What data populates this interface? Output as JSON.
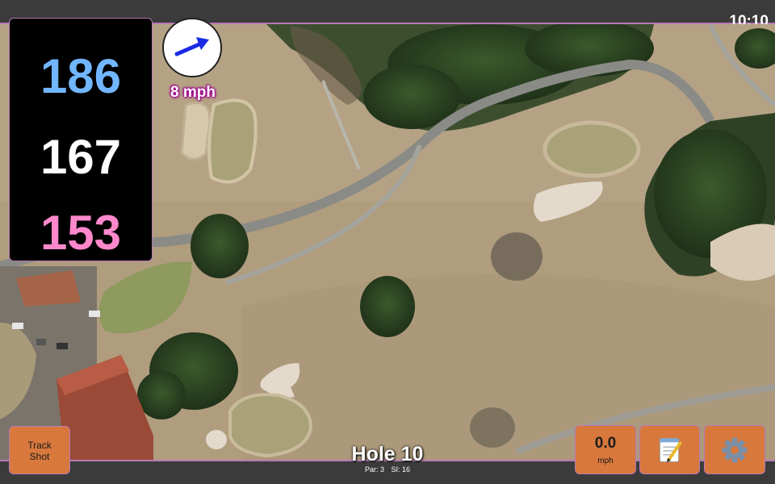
{
  "status": {
    "time": "10:10"
  },
  "distances": {
    "back": "186",
    "center": "167",
    "front": "153"
  },
  "wind": {
    "speed_label": "8 mph",
    "direction_icon": "arrow-right-up-icon"
  },
  "hole": {
    "title": "Hole 10",
    "par_label": "Par: 3",
    "si_label": "SI: 16"
  },
  "buttons": {
    "track_shot_label": "Track\nShot",
    "speed_value": "0.0",
    "speed_unit": "mph",
    "notes_icon": "notepad-icon",
    "settings_icon": "gear-icon"
  },
  "colors": {
    "back_distance": "#72b6ff",
    "center_distance": "#ffffff",
    "front_distance": "#ff88cc",
    "button_bg": "#d8783c",
    "accent_border": "#b77ab5",
    "wind_arrow": "#1a2ae6"
  }
}
